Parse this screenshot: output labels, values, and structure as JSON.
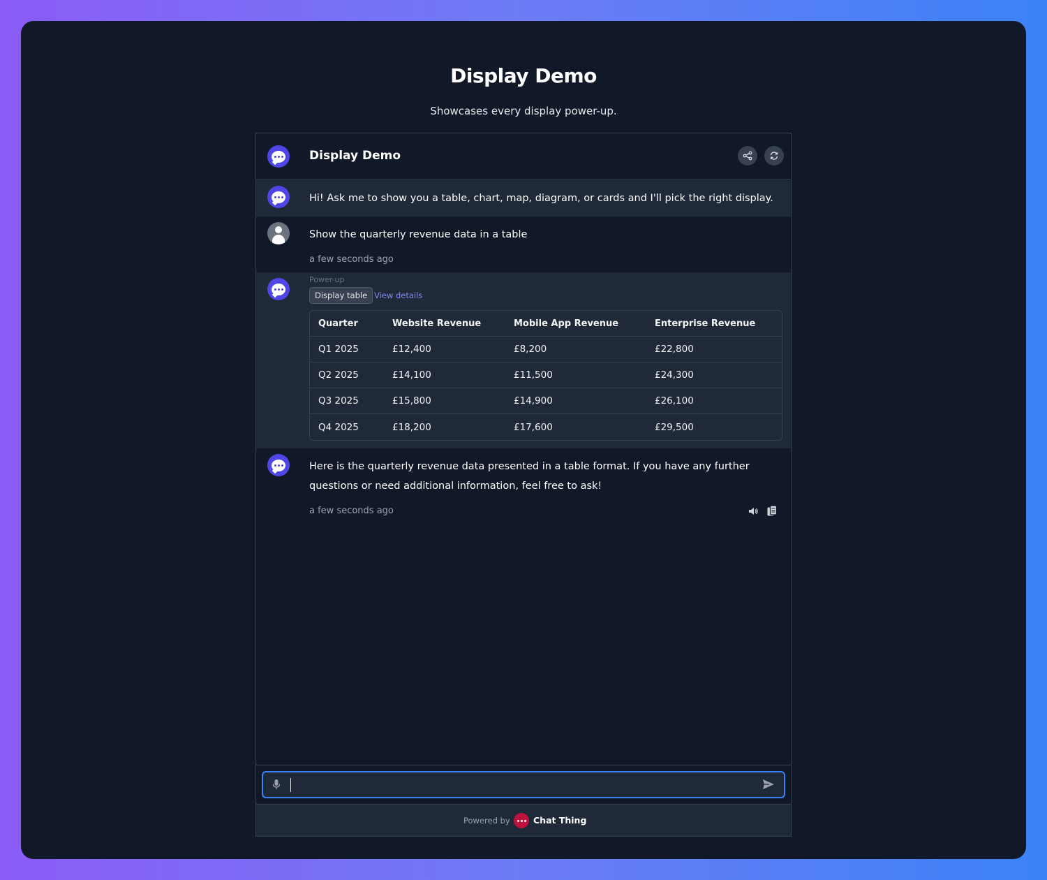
{
  "page": {
    "title": "Display Demo",
    "subtitle": "Showcases every display power-up."
  },
  "chat": {
    "header_title": "Display Demo",
    "share_icon": "share-icon",
    "refresh_icon": "refresh-icon",
    "messages": [
      {
        "role": "bot",
        "text": "Hi! Ask me to show you a table, chart, map, diagram, or cards and I'll pick the right display."
      },
      {
        "role": "user",
        "text": "Show the quarterly revenue data in a table",
        "time": "a few seconds ago"
      },
      {
        "role": "bot",
        "powerup_label": "Power-up",
        "powerup_chip": "Display table",
        "view_details": "View details",
        "table": {
          "headers": [
            "Quarter",
            "Website Revenue",
            "Mobile App Revenue",
            "Enterprise Revenue"
          ],
          "rows": [
            [
              "Q1 2025",
              "£12,400",
              "£8,200",
              "£22,800"
            ],
            [
              "Q2 2025",
              "£14,100",
              "£11,500",
              "£24,300"
            ],
            [
              "Q3 2025",
              "£15,800",
              "£14,900",
              "£26,100"
            ],
            [
              "Q4 2025",
              "£18,200",
              "£17,600",
              "£29,500"
            ]
          ]
        }
      },
      {
        "role": "bot",
        "text": "Here is the quarterly revenue data presented in a table format. If you have any further questions or need additional information, feel free to ask!",
        "time": "a few seconds ago",
        "speak_icon": "speaker-icon",
        "copy_icon": "copy-icon"
      }
    ],
    "input": {
      "value": "",
      "placeholder": "",
      "mic_icon": "microphone-icon",
      "send_icon": "send-icon"
    },
    "footer": {
      "powered_by": "Powered by",
      "brand": "Chat Thing"
    }
  },
  "colors": {
    "background_start": "#8b5cf6",
    "background_end": "#3b82f6",
    "panel": "#111827",
    "bot_avatar": "#4f46e5",
    "link": "#818cf8",
    "brand": "#be123c",
    "input_focus": "#3b82f6"
  }
}
